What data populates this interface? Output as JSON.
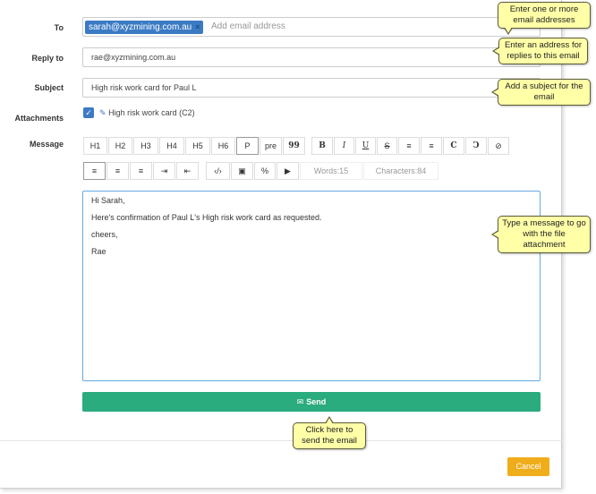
{
  "labels": {
    "to": "To",
    "reply_to": "Reply to",
    "subject": "Subject",
    "attachments": "Attachments",
    "message": "Message"
  },
  "to": {
    "recipient": "sarah@xyzmining.com.au",
    "remove_glyph": "×",
    "placeholder": "Add email address"
  },
  "reply_to": {
    "value": "rae@xyzmining.com.au"
  },
  "subject": {
    "value": "High risk work card for Paul L"
  },
  "attachment": {
    "checked": true,
    "check_glyph": "✓",
    "clip_glyph": "✎",
    "label": "High risk work card (C2)"
  },
  "toolbar": {
    "headings": [
      "H1",
      "H2",
      "H3",
      "H4",
      "H5",
      "H6",
      "P",
      "pre",
      "99"
    ],
    "format": [
      "B",
      "I",
      "U",
      "S",
      "≡",
      "≡",
      "C",
      "Ↄ",
      "⊘"
    ],
    "align": [
      "≡",
      "≡",
      "≡",
      "⇥",
      "⇤"
    ],
    "insert": [
      "‹/›",
      "▣",
      "%",
      "▶"
    ],
    "words": "Words:15",
    "characters": "Characters:84"
  },
  "message": {
    "lines": [
      "Hi Sarah,",
      "Here's confirmation of Paul L's High risk work card as requested.",
      "cheers,",
      "Rae"
    ]
  },
  "buttons": {
    "send_icon": "✉",
    "send": "Send",
    "cancel": "Cancel"
  },
  "callouts": {
    "to": "Enter one or more email addresses",
    "reply_to": "Enter an address for replies to this email",
    "subject": "Add a subject for the email",
    "message": "Type a message to go with the file attachment",
    "send": "Click here to send the email"
  },
  "colors": {
    "send": "#2bac7e",
    "cancel": "#f0ad1b",
    "chip": "#3b7bc4",
    "callout": "#ffffa8"
  }
}
